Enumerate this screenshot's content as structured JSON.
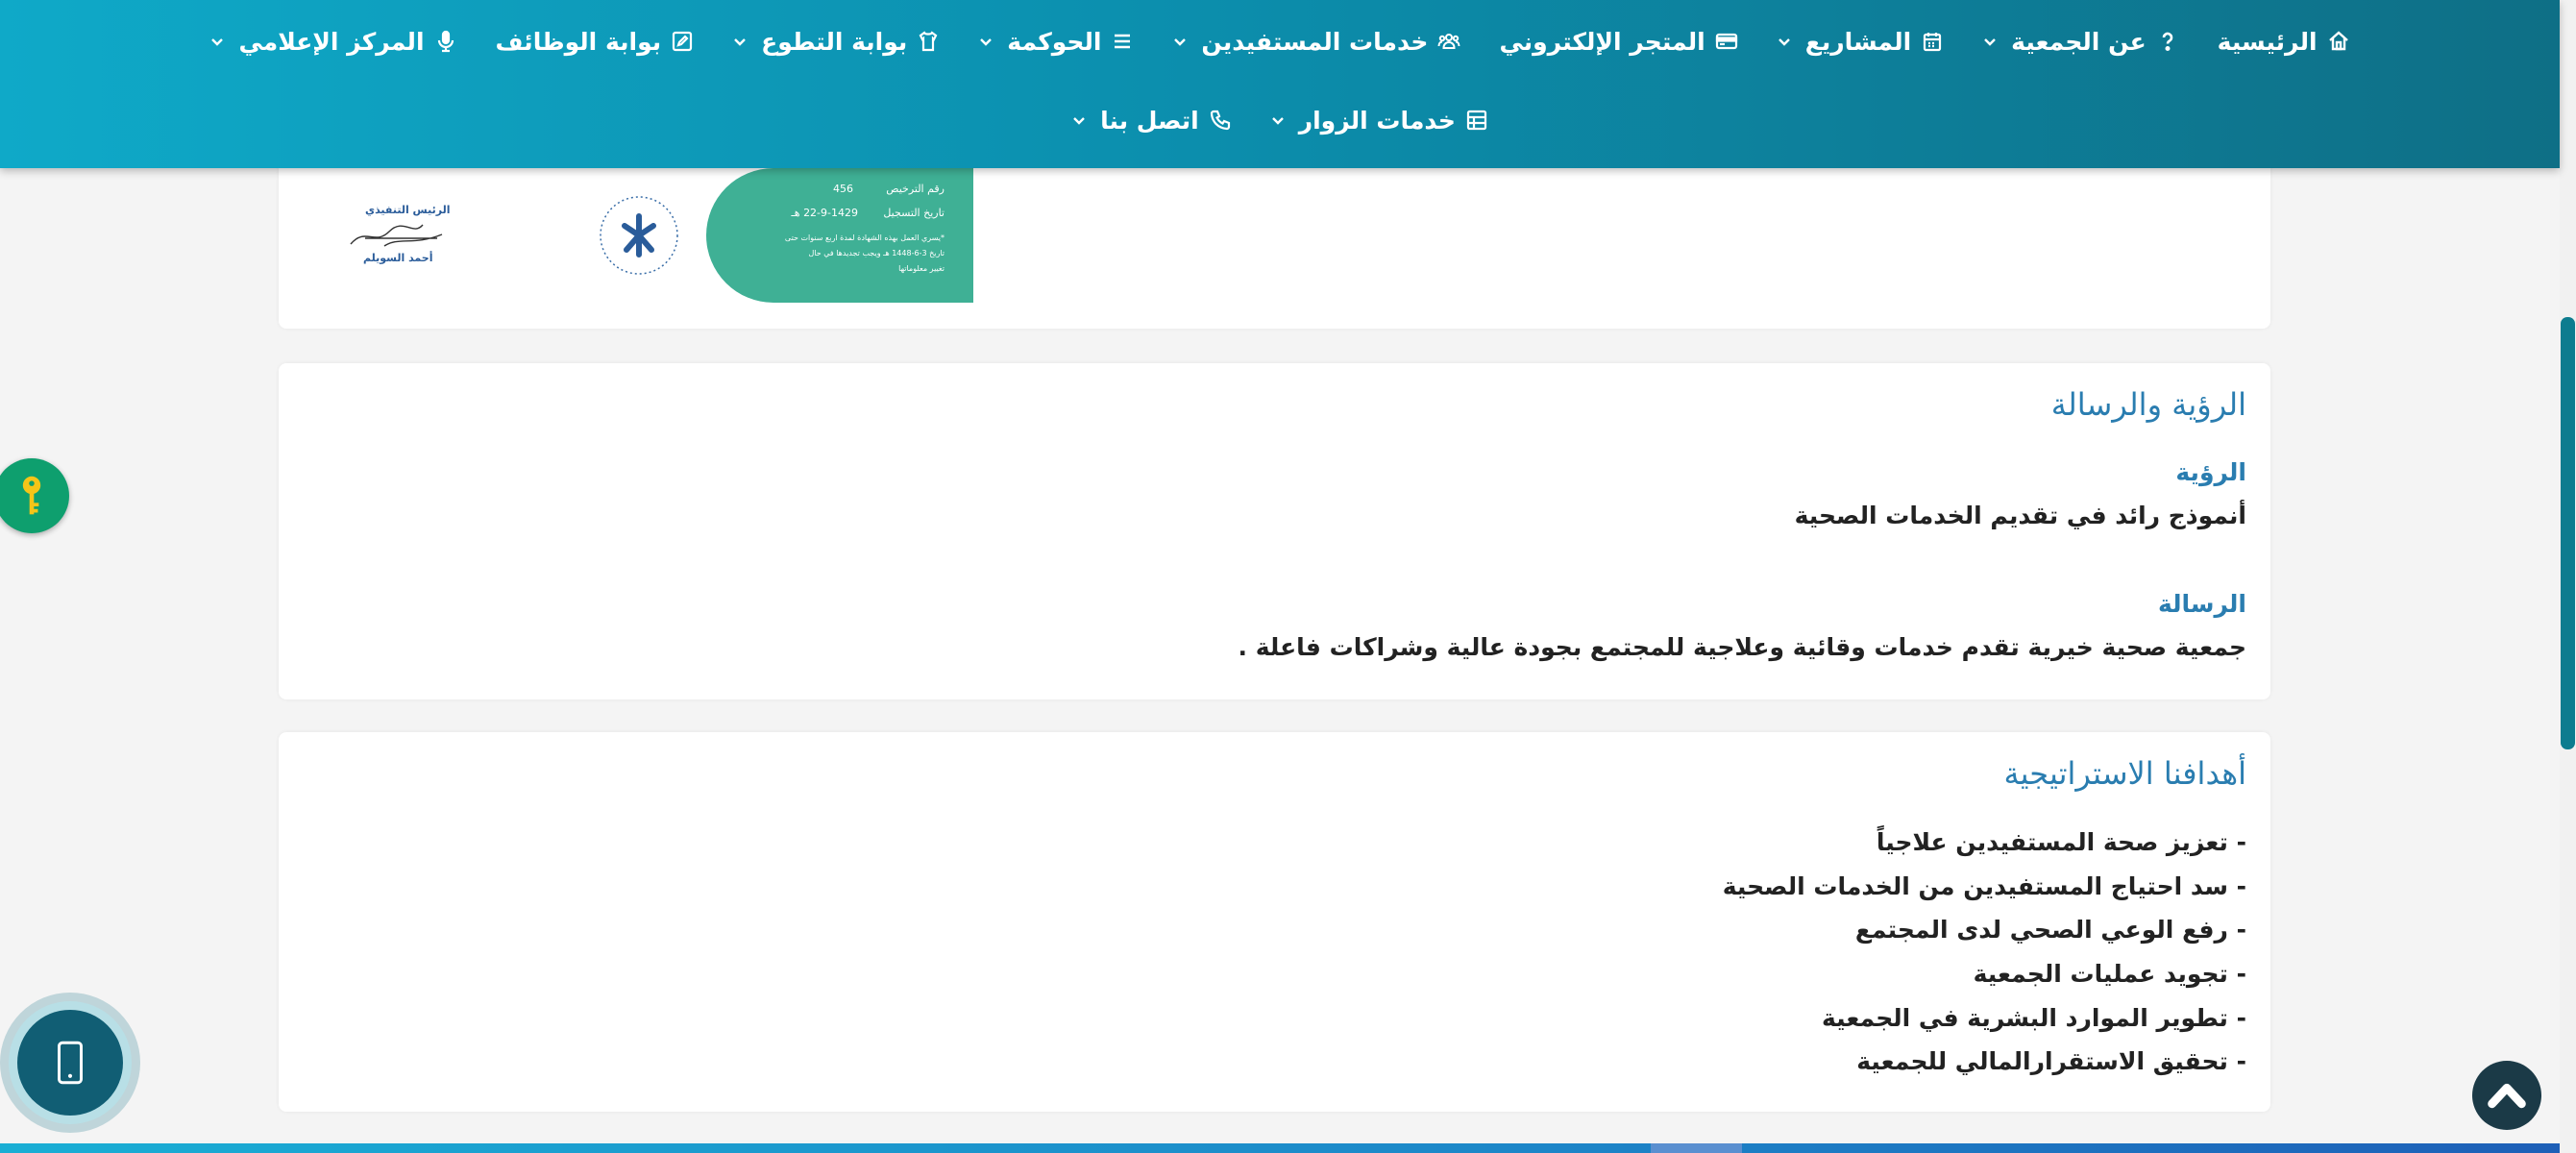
{
  "nav": {
    "row1": [
      {
        "label": "الرئيسية",
        "icon": "home-icon",
        "dropdown": false
      },
      {
        "label": "عن الجمعية",
        "icon": "question-icon",
        "dropdown": true
      },
      {
        "label": "المشاريع",
        "icon": "calendar-icon",
        "dropdown": true
      },
      {
        "label": "المتجر الإلكتروني",
        "icon": "credit-card-icon",
        "dropdown": false
      },
      {
        "label": "خدمات المستفيدين",
        "icon": "users-icon",
        "dropdown": true
      },
      {
        "label": "الحوكمة",
        "icon": "list-icon",
        "dropdown": true
      },
      {
        "label": "بوابة التطوع",
        "icon": "shirt-icon",
        "dropdown": true
      },
      {
        "label": "بوابة الوظائف",
        "icon": "edit-icon",
        "dropdown": false
      },
      {
        "label": "المركز الإعلامي",
        "icon": "microphone-icon",
        "dropdown": true
      }
    ],
    "row2": [
      {
        "label": "خدمات الزوار",
        "icon": "table-icon",
        "dropdown": true
      },
      {
        "label": "اتصل بنا",
        "icon": "phone-icon",
        "dropdown": true
      }
    ]
  },
  "certificate": {
    "reg_no_label": "رقم الترخيص",
    "reg_no": "456",
    "reg_date_label": "تاريخ التسجيل",
    "reg_date": "22-9-1429 هـ",
    "note_line1": "*يسري العمل بهذه الشهادة لمدة اربع سنوات حتى",
    "note_line2": "تاريخ 3-6-1448 هـ ويجب تجديدها في حال",
    "note_line3": "تغيير معلوماتها",
    "signature_title": "الرئيس التنفيذي",
    "signature_name": "أحمد السويلم"
  },
  "vision_mission": {
    "title": "الرؤية والرسالة",
    "vision_label": "الرؤية",
    "vision_text": "أنموذج رائد في تقديم الخدمات الصحية",
    "mission_label": "الرسالة",
    "mission_text": "جمعية صحية خيرية تقدم خدمات وقائية وعلاجية للمجتمع بجودة عالية وشراكات فاعلة ."
  },
  "goals": {
    "title": "أهدافنا الاستراتيجية",
    "items": [
      "- تعزيز صحة المستفيدين علاجياً",
      "- سد احتياج المستفيدين من الخدمات الصحية",
      "- رفع الوعي الصحي لدى المجتمع",
      "- تجويد عمليات الجمعية",
      "- تطوير الموارد البشرية في الجمعية",
      "- تحقيق الاستقرارالمالي  للجمعية"
    ]
  },
  "colors": {
    "nav_gradient_start": "#0fa9c8",
    "nav_gradient_end": "#0e6f86",
    "heading_blue": "#2a7db0",
    "cert_green": "#3fb095",
    "key_badge": "#0e9f6e",
    "phone_button": "#115e74",
    "scroll_top": "#1b3a47"
  },
  "widgets": {
    "accessibility_icon": "key-icon",
    "mobile_icon": "mobile-phone-icon",
    "scroll_top_icon": "chevron-up-icon"
  }
}
